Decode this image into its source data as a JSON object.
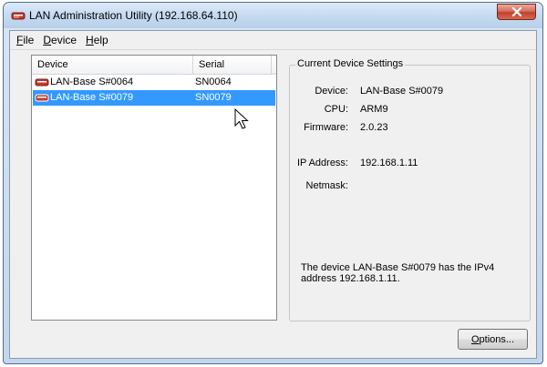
{
  "window": {
    "title": "LAN Administration Utility (192.168.64.110)",
    "close_glyph": "X"
  },
  "menu": {
    "file": "File",
    "device": "Device",
    "help": "Help"
  },
  "device_list": {
    "columns": [
      "Device",
      "Serial"
    ],
    "rows": [
      {
        "device": "LAN-Base S#0064",
        "serial": "SN0064",
        "selected": false
      },
      {
        "device": "LAN-Base S#0079",
        "serial": "SN0079",
        "selected": true
      }
    ]
  },
  "settings": {
    "group_title": "Current Device Settings",
    "device_label": "Device:",
    "device_value": "LAN-Base S#0079",
    "cpu_label": "CPU:",
    "cpu_value": "ARM9",
    "firmware_label": "Firmware:",
    "firmware_value": "2.0.23",
    "ip_label": "IP Address:",
    "ip_value": "192.168.1.11",
    "netmask_label": "Netmask:",
    "netmask_value": "",
    "message": "The device LAN-Base S#0079 has the IPv4 address 192.168.1.11."
  },
  "buttons": {
    "options": "Options..."
  },
  "icons": {
    "app": "lan-device-icon",
    "row": "lan-device-icon",
    "cursor": "mouse-pointer-icon"
  },
  "colors": {
    "selection": "#3399ff",
    "device_icon": "#c0392b"
  }
}
